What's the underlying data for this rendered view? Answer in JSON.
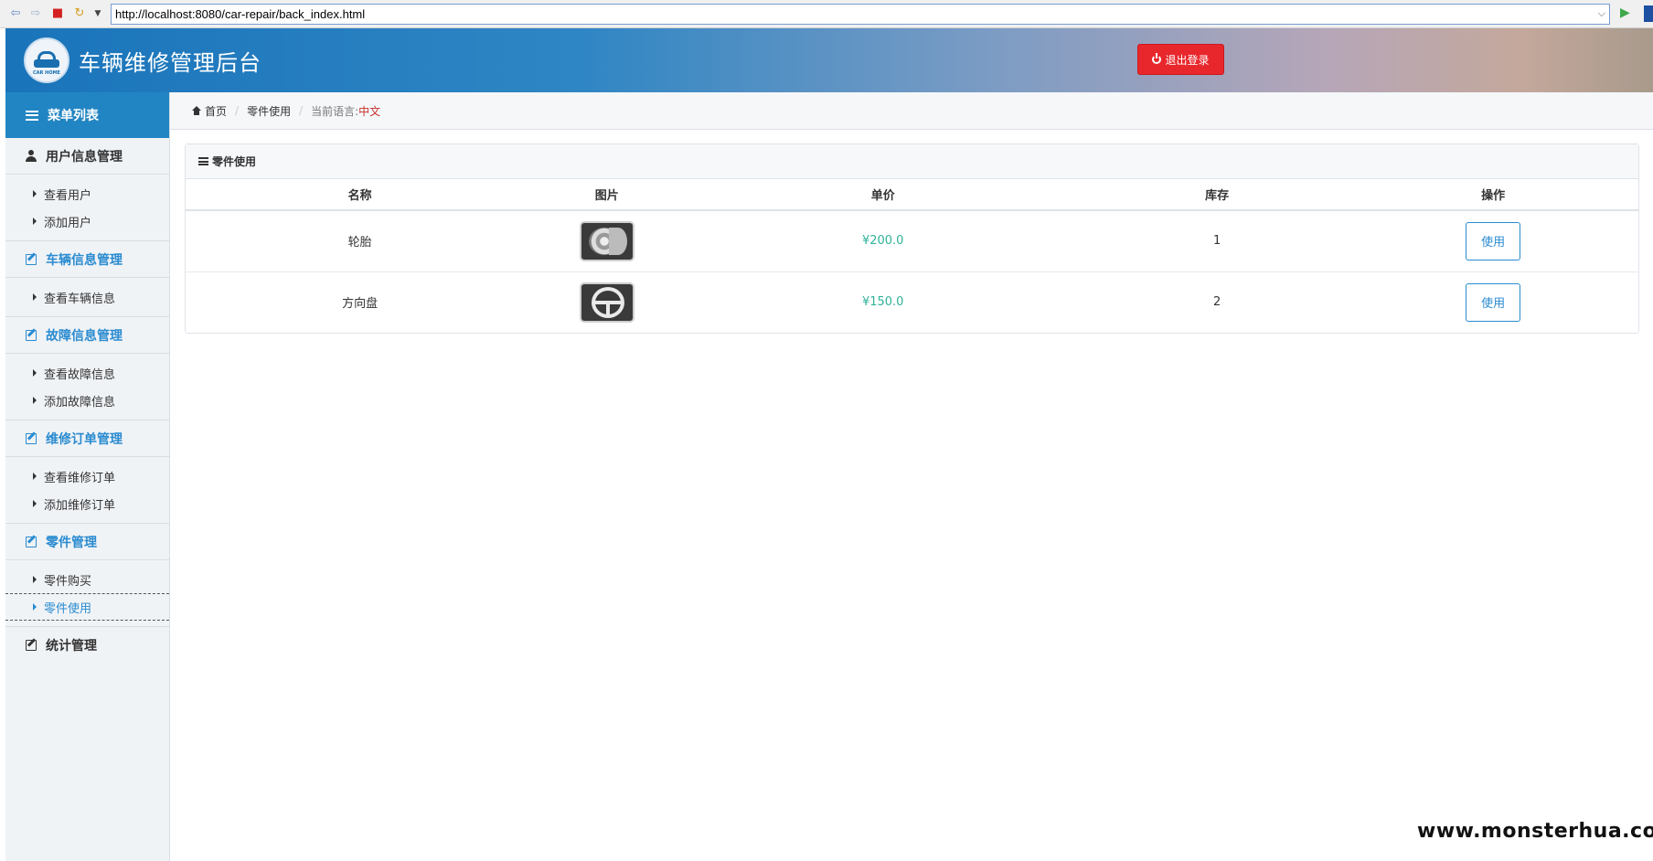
{
  "browser": {
    "url": "http://localhost:8080/car-repair/back_index.html"
  },
  "header": {
    "logo_text": "CAR HOME",
    "title": "车辆维修管理后台",
    "logout_label": "退出登录"
  },
  "sidebar": {
    "menu_title": "菜单列表",
    "groups": [
      {
        "label": "用户信息管理",
        "items": [
          "查看用户",
          "添加用户"
        ]
      },
      {
        "label": "车辆信息管理",
        "items": [
          "查看车辆信息"
        ]
      },
      {
        "label": "故障信息管理",
        "items": [
          "查看故障信息",
          "添加故障信息"
        ]
      },
      {
        "label": "维修订单管理",
        "items": [
          "查看维修订单",
          "添加维修订单"
        ]
      },
      {
        "label": "零件管理",
        "items": [
          "零件购买",
          "零件使用"
        ]
      },
      {
        "label": "统计管理",
        "items": []
      }
    ]
  },
  "breadcrumb": {
    "home": "首页",
    "current": "零件使用",
    "lang_label": "当前语言:",
    "lang_value": "中文"
  },
  "panel": {
    "title": "零件使用",
    "columns": [
      "名称",
      "图片",
      "单价",
      "库存",
      "操作"
    ],
    "rows": [
      {
        "name": "轮胎",
        "image_icon": "tire-icon",
        "price": "¥200.0",
        "stock": "1",
        "action": "使用"
      },
      {
        "name": "方向盘",
        "image_icon": "steering-wheel-icon",
        "price": "¥150.0",
        "stock": "2",
        "action": "使用"
      }
    ]
  },
  "watermark": "www.monsterhua.com",
  "colors": {
    "header_blue": "#1a74ba",
    "menu_blue": "#2285c3",
    "link_blue": "#2a8bd0",
    "logout_red": "#e8272d",
    "price_green": "#2fb39a",
    "lang_red": "#c9302c"
  }
}
